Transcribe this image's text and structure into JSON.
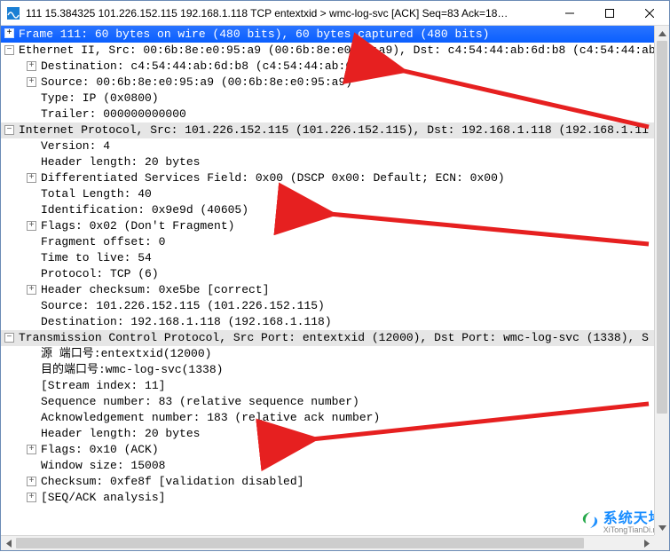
{
  "window": {
    "title": "111 15.384325 101.226.152.115 192.168.1.118 TCP entextxid > wmc-log-svc [ACK] Seq=83 Ack=18…"
  },
  "frame_header": "Frame 111: 60 bytes on wire (480 bits), 60 bytes captured (480 bits)",
  "eth": {
    "summary": "Ethernet II, Src: 00:6b:8e:e0:95:a9 (00:6b:8e:e0:95:a9), Dst: c4:54:44:ab:6d:b8 (c4:54:44:ab",
    "dst": "Destination: c4:54:44:ab:6d:b8 (c4:54:44:ab:6d:b8)",
    "src": "Source: 00:6b:8e:e0:95:a9 (00:6b:8e:e0:95:a9)",
    "type": "Type: IP (0x0800)",
    "trailer": "Trailer: 000000000000"
  },
  "ip": {
    "summary": "Internet Protocol, Src: 101.226.152.115 (101.226.152.115), Dst: 192.168.1.118 (192.168.1.11",
    "version": "Version: 4",
    "hlen": "Header length: 20 bytes",
    "dsf": "Differentiated Services Field: 0x00 (DSCP 0x00: Default; ECN: 0x00)",
    "tlen": "Total Length: 40",
    "id": "Identification: 0x9e9d (40605)",
    "flags": "Flags: 0x02 (Don't Fragment)",
    "frag": "Fragment offset: 0",
    "ttl": "Time to live: 54",
    "proto": "Protocol: TCP (6)",
    "hcksum": "Header checksum: 0xe5be [correct]",
    "srcaddr": "Source: 101.226.152.115 (101.226.152.115)",
    "dstaddr": "Destination: 192.168.1.118 (192.168.1.118)"
  },
  "tcp": {
    "summary": "Transmission Control Protocol, Src Port: entextxid (12000), Dst Port: wmc-log-svc (1338), S",
    "srcport": "源  端口号:entextxid(12000)",
    "dstport": "目的端口号:wmc-log-svc(1338)",
    "stream": "[Stream index: 11]",
    "seq": "Sequence number: 83    (relative sequence number)",
    "ack": "Acknowledgement number: 183    (relative ack number)",
    "hlen": "Header length: 20 bytes",
    "flags": "Flags: 0x10 (ACK)",
    "win": "Window size: 15008",
    "cksum": "Checksum: 0xfe8f [validation disabled]",
    "seqack": "[SEQ/ACK analysis]"
  },
  "watermark": {
    "zh": "系统天地",
    "en": "XiTongTianDi.net"
  }
}
